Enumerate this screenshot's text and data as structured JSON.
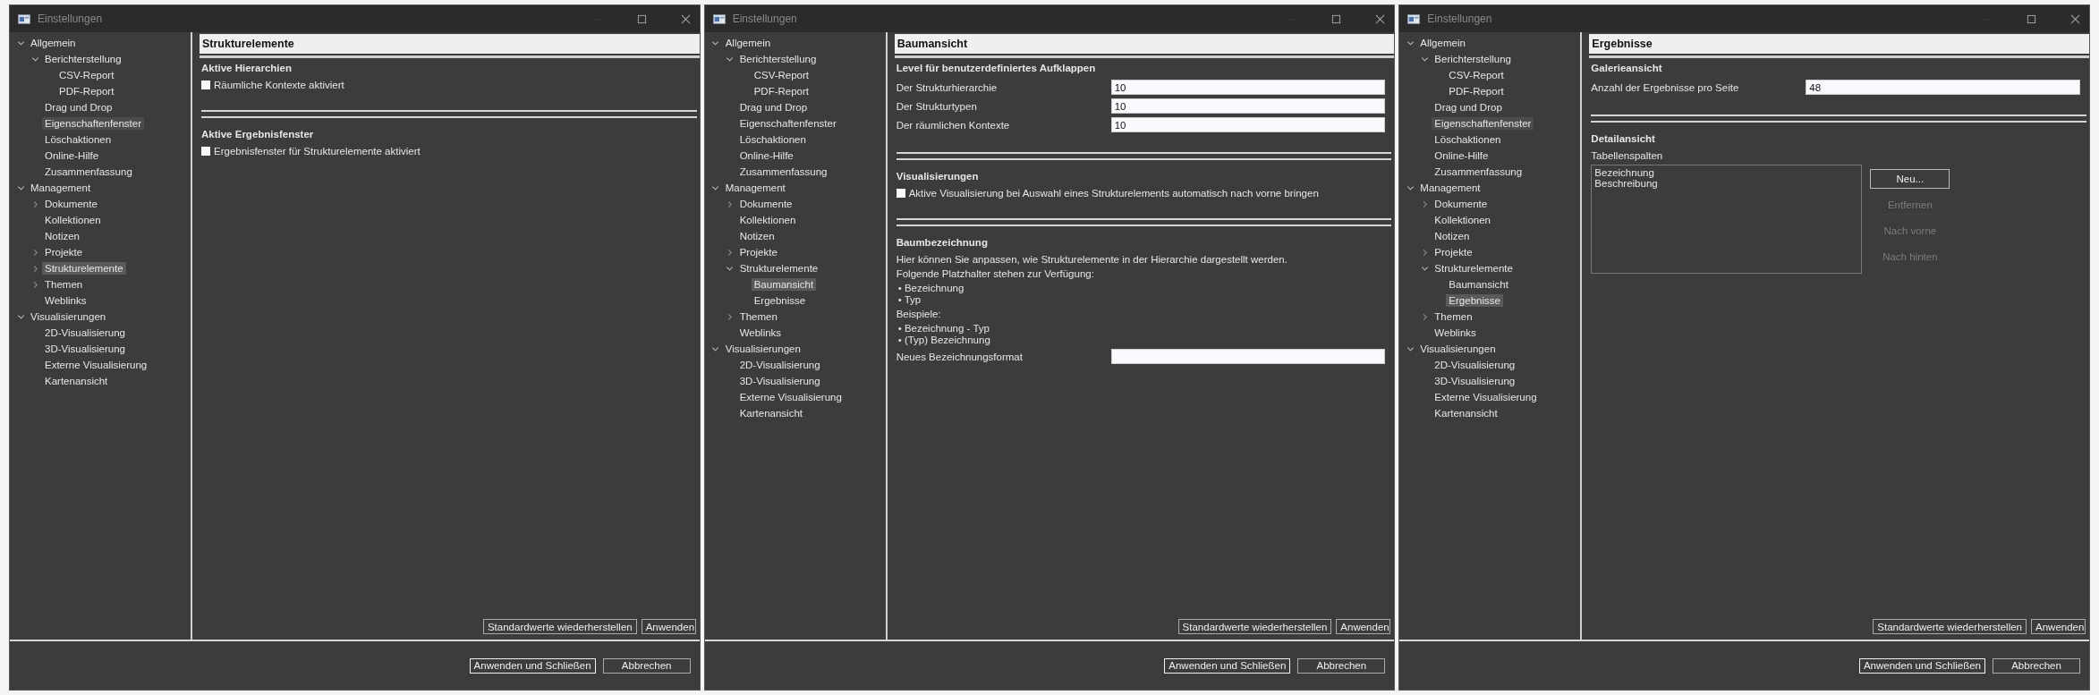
{
  "windows": [
    {
      "title": "Einstellungen",
      "tree": [
        {
          "label": "Allgemein",
          "expanded": true,
          "selected": false,
          "hovered": false,
          "children": [
            {
              "label": "Berichterstellung",
              "expanded": true,
              "selected": false,
              "hovered": false,
              "children": [
                {
                  "label": "CSV-Report",
                  "selected": false,
                  "hovered": false
                },
                {
                  "label": "PDF-Report",
                  "selected": false,
                  "hovered": false
                }
              ]
            },
            {
              "label": "Drag und Drop",
              "selected": false,
              "hovered": false
            },
            {
              "label": "Eigenschaftenfenster",
              "selected": false,
              "hovered": true
            },
            {
              "label": "Löschaktionen",
              "selected": false,
              "hovered": false
            },
            {
              "label": "Online-Hilfe",
              "selected": false,
              "hovered": false
            },
            {
              "label": "Zusammenfassung",
              "selected": false,
              "hovered": false
            }
          ]
        },
        {
          "label": "Management",
          "expanded": true,
          "selected": false,
          "hovered": false,
          "children": [
            {
              "label": "Dokumente",
              "expanded": false,
              "selected": false,
              "hovered": false
            },
            {
              "label": "Kollektionen",
              "selected": false,
              "hovered": false
            },
            {
              "label": "Notizen",
              "selected": false,
              "hovered": false
            },
            {
              "label": "Projekte",
              "expanded": false,
              "selected": false,
              "hovered": false
            },
            {
              "label": "Strukturelemente",
              "expanded": false,
              "selected": true,
              "hovered": false
            },
            {
              "label": "Themen",
              "expanded": false,
              "selected": false,
              "hovered": false
            },
            {
              "label": "Weblinks",
              "selected": false,
              "hovered": false
            }
          ]
        },
        {
          "label": "Visualisierungen",
          "expanded": true,
          "selected": false,
          "hovered": false,
          "children": [
            {
              "label": "2D-Visualisierung",
              "selected": false,
              "hovered": false
            },
            {
              "label": "3D-Visualisierung",
              "selected": false,
              "hovered": false
            },
            {
              "label": "Externe Visualisierung",
              "selected": false,
              "hovered": false
            },
            {
              "label": "Kartenansicht",
              "selected": false,
              "hovered": false
            }
          ]
        }
      ],
      "page": {
        "title": "Strukturelemente",
        "sections": [
          {
            "title": "Aktive Hierarchien",
            "rows": [
              {
                "kind": "checkbox",
                "label": "Räumliche Kontexte aktiviert",
                "checked": false
              }
            ]
          },
          {
            "title": "Aktive Ergebnisfenster",
            "rows": [
              {
                "kind": "checkbox",
                "label": "Ergebnisfenster für Strukturelemente aktiviert",
                "checked": false
              }
            ]
          }
        ]
      },
      "page_buttons": [
        "Standardwerte wiederherstellen",
        "Anwenden"
      ],
      "dialog_buttons": [
        {
          "label": "Anwenden und Schließen",
          "focused": true
        },
        {
          "label": "Abbrechen",
          "focused": false
        }
      ]
    },
    {
      "title": "Einstellungen",
      "tree": [
        {
          "label": "Allgemein",
          "expanded": true,
          "selected": false,
          "hovered": false,
          "children": [
            {
              "label": "Berichterstellung",
              "expanded": true,
              "selected": false,
              "hovered": false,
              "children": [
                {
                  "label": "CSV-Report",
                  "selected": false,
                  "hovered": false
                },
                {
                  "label": "PDF-Report",
                  "selected": false,
                  "hovered": false
                }
              ]
            },
            {
              "label": "Drag und Drop",
              "selected": false,
              "hovered": false
            },
            {
              "label": "Eigenschaftenfenster",
              "selected": false,
              "hovered": false
            },
            {
              "label": "Löschaktionen",
              "selected": false,
              "hovered": false
            },
            {
              "label": "Online-Hilfe",
              "selected": false,
              "hovered": false
            },
            {
              "label": "Zusammenfassung",
              "selected": false,
              "hovered": false
            }
          ]
        },
        {
          "label": "Management",
          "expanded": true,
          "selected": false,
          "hovered": false,
          "children": [
            {
              "label": "Dokumente",
              "expanded": false,
              "selected": false,
              "hovered": false
            },
            {
              "label": "Kollektionen",
              "selected": false,
              "hovered": false
            },
            {
              "label": "Notizen",
              "selected": false,
              "hovered": false
            },
            {
              "label": "Projekte",
              "expanded": false,
              "selected": false,
              "hovered": false
            },
            {
              "label": "Strukturelemente",
              "expanded": true,
              "selected": false,
              "hovered": false,
              "children": [
                {
                  "label": "Baumansicht",
                  "selected": true,
                  "hovered": false
                },
                {
                  "label": "Ergebnisse",
                  "selected": false,
                  "hovered": false
                }
              ]
            },
            {
              "label": "Themen",
              "expanded": false,
              "selected": false,
              "hovered": false
            },
            {
              "label": "Weblinks",
              "selected": false,
              "hovered": false
            }
          ]
        },
        {
          "label": "Visualisierungen",
          "expanded": true,
          "selected": false,
          "hovered": false,
          "children": [
            {
              "label": "2D-Visualisierung",
              "selected": false,
              "hovered": false
            },
            {
              "label": "3D-Visualisierung",
              "selected": false,
              "hovered": false
            },
            {
              "label": "Externe Visualisierung",
              "selected": false,
              "hovered": false
            },
            {
              "label": "Kartenansicht",
              "selected": false,
              "hovered": false
            }
          ]
        }
      ],
      "page": {
        "title": "Baumansicht",
        "sections": [
          {
            "title": "Level für benutzerdefiniertes Aufklappen",
            "rows": [
              {
                "kind": "field",
                "label": "Der Strukturhierarchie",
                "value": "10"
              },
              {
                "kind": "field",
                "label": "Der Strukturtypen",
                "value": "10"
              },
              {
                "kind": "field",
                "label": "Der räumlichen Kontexte",
                "value": "10"
              }
            ]
          },
          {
            "title": "Visualisierungen",
            "rows": [
              {
                "kind": "checkbox",
                "label": "Aktive Visualisierung bei Auswahl eines Strukturelements automatisch nach vorne bringen",
                "checked": false
              }
            ]
          },
          {
            "title": "Baumbezeichnung",
            "rows": [
              {
                "kind": "text",
                "text": "Hier können Sie anpassen, wie Strukturelemente in der Hierarchie dargestellt werden."
              },
              {
                "kind": "text",
                "text": "Folgende Platzhalter stehen zur Verfügung:"
              },
              {
                "kind": "bullets",
                "items": [
                  "• Bezeichnung",
                  "• Typ"
                ]
              },
              {
                "kind": "text",
                "text": "Beispiele:"
              },
              {
                "kind": "bullets",
                "items": [
                  "• Bezeichnung - Typ",
                  "• (Typ) Bezeichnung"
                ]
              },
              {
                "kind": "field",
                "label": "Neues Bezeichnungsformat"
              }
            ]
          }
        ]
      },
      "page_buttons": [
        "Standardwerte wiederherstellen",
        "Anwenden"
      ],
      "dialog_buttons": [
        {
          "label": "Anwenden und Schließen",
          "focused": true
        },
        {
          "label": "Abbrechen",
          "focused": false
        }
      ]
    },
    {
      "title": "Einstellungen",
      "tree": [
        {
          "label": "Allgemein",
          "expanded": true,
          "selected": false,
          "hovered": false,
          "children": [
            {
              "label": "Berichterstellung",
              "expanded": true,
              "selected": false,
              "hovered": false,
              "children": [
                {
                  "label": "CSV-Report",
                  "selected": false,
                  "hovered": false
                },
                {
                  "label": "PDF-Report",
                  "selected": false,
                  "hovered": false
                }
              ]
            },
            {
              "label": "Drag und Drop",
              "selected": false,
              "hovered": false
            },
            {
              "label": "Eigenschaftenfenster",
              "selected": false,
              "hovered": true
            },
            {
              "label": "Löschaktionen",
              "selected": false,
              "hovered": false
            },
            {
              "label": "Online-Hilfe",
              "selected": false,
              "hovered": false
            },
            {
              "label": "Zusammenfassung",
              "selected": false,
              "hovered": false
            }
          ]
        },
        {
          "label": "Management",
          "expanded": true,
          "selected": false,
          "hovered": false,
          "children": [
            {
              "label": "Dokumente",
              "expanded": false,
              "selected": false,
              "hovered": false
            },
            {
              "label": "Kollektionen",
              "selected": false,
              "hovered": false
            },
            {
              "label": "Notizen",
              "selected": false,
              "hovered": false
            },
            {
              "label": "Projekte",
              "expanded": false,
              "selected": false,
              "hovered": false
            },
            {
              "label": "Strukturelemente",
              "expanded": true,
              "selected": false,
              "hovered": false,
              "children": [
                {
                  "label": "Baumansicht",
                  "selected": false,
                  "hovered": false
                },
                {
                  "label": "Ergebnisse",
                  "selected": true,
                  "hovered": false
                }
              ]
            },
            {
              "label": "Themen",
              "expanded": false,
              "selected": false,
              "hovered": false
            },
            {
              "label": "Weblinks",
              "selected": false,
              "hovered": false
            }
          ]
        },
        {
          "label": "Visualisierungen",
          "expanded": true,
          "selected": false,
          "hovered": false,
          "children": [
            {
              "label": "2D-Visualisierung",
              "selected": false,
              "hovered": false
            },
            {
              "label": "3D-Visualisierung",
              "selected": false,
              "hovered": false
            },
            {
              "label": "Externe Visualisierung",
              "selected": false,
              "hovered": false
            },
            {
              "label": "Kartenansicht",
              "selected": false,
              "hovered": false
            }
          ]
        }
      ],
      "page": {
        "title": "Ergebnisse",
        "sections": [
          {
            "title": "Galerieansicht",
            "rows": [
              {
                "kind": "field",
                "label": "Anzahl der Ergebnisse pro Seite",
                "value": "48"
              }
            ]
          },
          {
            "title": "Detailansicht",
            "rows": [
              {
                "kind": "text",
                "text": "Tabellenspalten"
              },
              {
                "kind": "list_editor",
                "items": [
                  "Bezeichnung",
                  "Beschreibung"
                ],
                "buttons": [
                  {
                    "label": "Neu...",
                    "disabled": false
                  },
                  {
                    "label": "Entfernen",
                    "disabled": true
                  },
                  {
                    "label": "Nach vorne",
                    "disabled": true
                  },
                  {
                    "label": "Nach hinten",
                    "disabled": true
                  }
                ]
              }
            ]
          }
        ]
      },
      "page_buttons": [
        "Standardwerte wiederherstellen",
        "Anwenden"
      ],
      "dialog_buttons": [
        {
          "label": "Anwenden und Schließen",
          "focused": true
        },
        {
          "label": "Abbrechen",
          "focused": false
        }
      ]
    }
  ]
}
